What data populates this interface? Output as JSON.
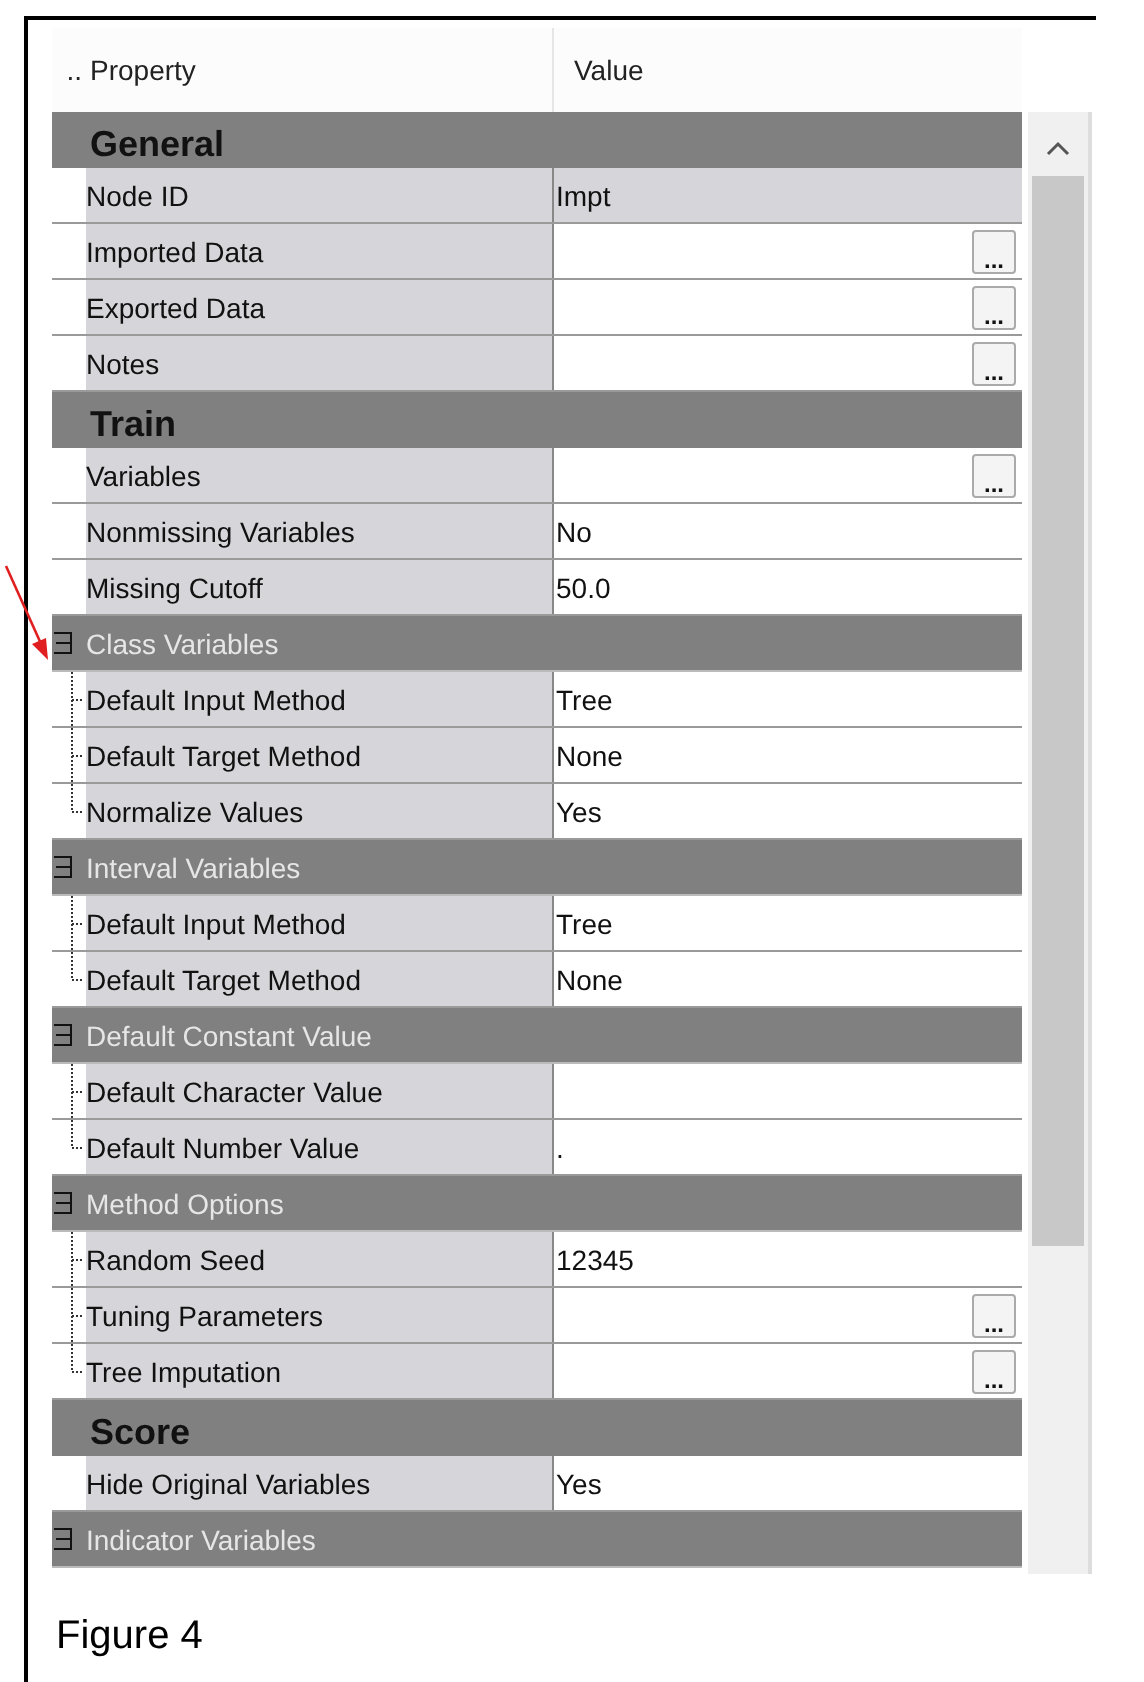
{
  "columns": [
    "..",
    "Property",
    "Value"
  ],
  "sections": [
    {
      "title": "General",
      "items": [
        {
          "kind": "property",
          "property": "Node ID",
          "value": "Impt",
          "readonly": true
        },
        {
          "kind": "property",
          "property": "Imported Data",
          "button": "..."
        },
        {
          "kind": "property",
          "property": "Exported Data",
          "button": "..."
        },
        {
          "kind": "property",
          "property": "Notes",
          "button": "..."
        }
      ]
    },
    {
      "title": "Train",
      "items": [
        {
          "kind": "property",
          "property": "Variables",
          "button": "..."
        },
        {
          "kind": "property",
          "property": "Nonmissing Variables",
          "value": "No"
        },
        {
          "kind": "property",
          "property": "Missing Cutoff",
          "value": "50.0"
        },
        {
          "kind": "group",
          "title": "Class Variables",
          "expanded": true,
          "children": [
            {
              "kind": "property",
              "property": "Default Input Method",
              "value": "Tree"
            },
            {
              "kind": "property",
              "property": "Default Target Method",
              "value": "None"
            },
            {
              "kind": "property",
              "property": "Normalize Values",
              "value": "Yes"
            }
          ]
        },
        {
          "kind": "group",
          "title": "Interval Variables",
          "expanded": true,
          "children": [
            {
              "kind": "property",
              "property": "Default Input Method",
              "value": "Tree"
            },
            {
              "kind": "property",
              "property": "Default Target Method",
              "value": "None"
            }
          ]
        },
        {
          "kind": "group",
          "title": "Default Constant Value",
          "expanded": true,
          "children": [
            {
              "kind": "property",
              "property": "Default Character Value"
            },
            {
              "kind": "property",
              "property": "Default Number Value",
              "value": "."
            }
          ]
        },
        {
          "kind": "group",
          "title": "Method Options",
          "expanded": true,
          "children": [
            {
              "kind": "property",
              "property": "Random Seed",
              "value": "12345"
            },
            {
              "kind": "property",
              "property": "Tuning Parameters",
              "button": "..."
            },
            {
              "kind": "property",
              "property": "Tree Imputation",
              "button": "..."
            }
          ]
        }
      ]
    },
    {
      "title": "Score",
      "items": [
        {
          "kind": "property",
          "property": "Hide Original Variables",
          "value": "Yes"
        },
        {
          "kind": "group",
          "title": "Indicator Variables",
          "expanded": true
        }
      ]
    }
  ],
  "caption": "Figure 4"
}
